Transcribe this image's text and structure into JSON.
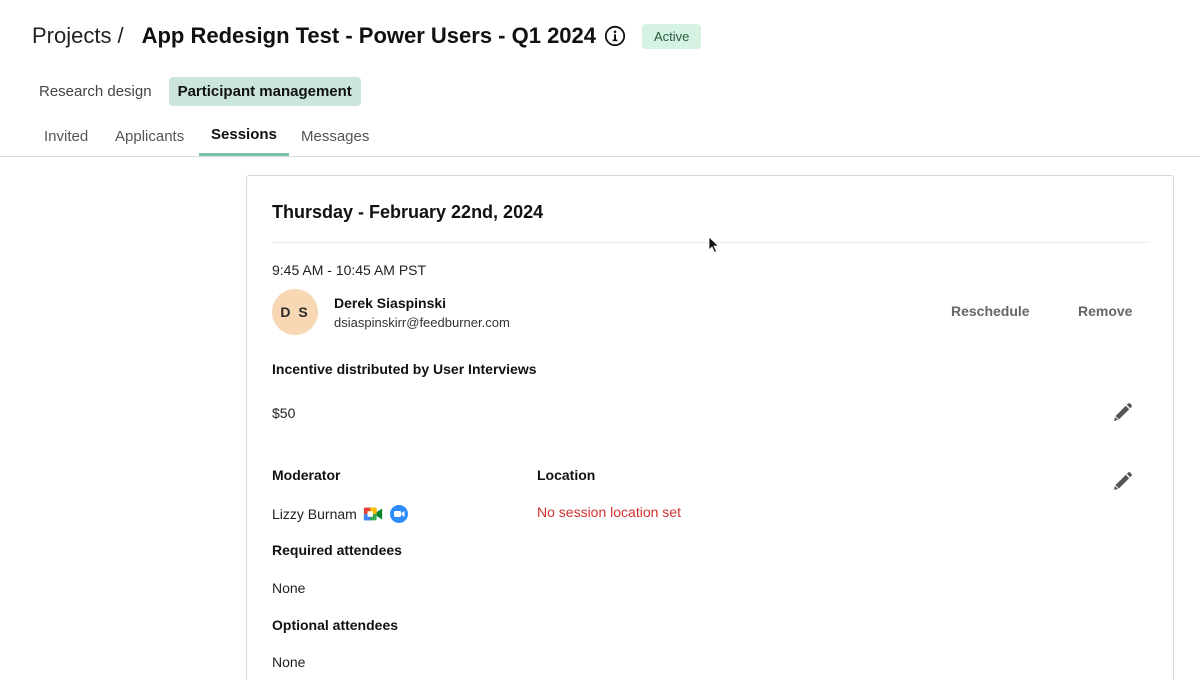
{
  "header": {
    "breadcrumb": "Projects",
    "separator": "/",
    "title": "App Redesign Test - Power Users - Q1 2024",
    "status": "Active",
    "info_icon": "info-circle-icon"
  },
  "modes": [
    {
      "label": "Research design",
      "active": false
    },
    {
      "label": "Participant management",
      "active": true
    }
  ],
  "tabs": [
    {
      "label": "Invited",
      "active": false
    },
    {
      "label": "Applicants",
      "active": false
    },
    {
      "label": "Sessions",
      "active": true
    },
    {
      "label": "Messages",
      "active": false
    }
  ],
  "session": {
    "date": "Thursday - February 22nd, 2024",
    "time": "9:45 AM - 10:45 AM PST",
    "participant": {
      "initials": "D S",
      "name": "Derek Siaspinski",
      "email": "dsiaspinskirr@feedburner.com"
    },
    "actions": {
      "reschedule": "Reschedule",
      "remove": "Remove"
    },
    "incentive": {
      "label": "Incentive distributed by User Interviews",
      "amount": "$50"
    },
    "moderator": {
      "label": "Moderator",
      "name": "Lizzy Burnam",
      "icons": [
        "google-meet-icon",
        "zoom-icon"
      ]
    },
    "location": {
      "label": "Location",
      "value": "No session location set"
    },
    "required_attendees": {
      "label": "Required attendees",
      "value": "None"
    },
    "optional_attendees": {
      "label": "Optional attendees",
      "value": "None"
    }
  },
  "colors": {
    "accent": "#7cc1ad",
    "mode_active_bg": "#cbe5dc",
    "badge_bg": "#d6f2e3",
    "avatar_bg": "#f7d7b4",
    "error": "#d32f2f"
  }
}
